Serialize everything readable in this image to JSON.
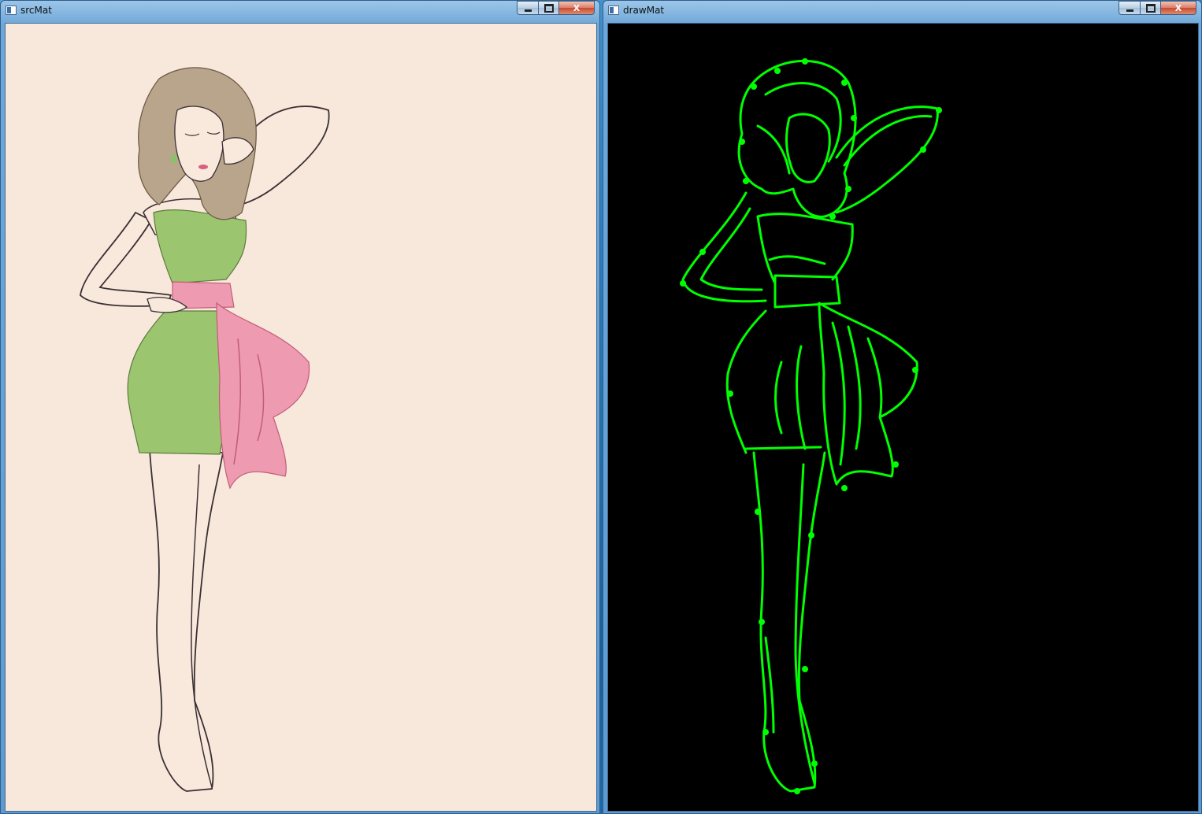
{
  "windows": [
    {
      "title": "srcMat",
      "buttons": {
        "minimize": "minimize",
        "maximize": "maximize",
        "close": "X"
      },
      "image": {
        "content": "fashion-illustration",
        "background": "#f8e8db",
        "dress_color": "#9bc56e",
        "sash_color": "#ee9ab0",
        "hair_color": "#b9a58c"
      }
    },
    {
      "title": "drawMat",
      "buttons": {
        "minimize": "minimize",
        "maximize": "maximize",
        "close": "X"
      },
      "image": {
        "content": "green-contour-drawing",
        "background": "#000000",
        "contour_color": "#00ff00"
      }
    }
  ]
}
